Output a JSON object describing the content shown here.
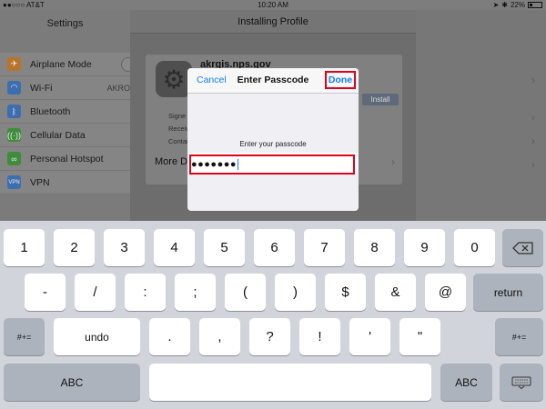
{
  "status": {
    "carrier": "●●○○○ AT&T",
    "time": "10:20 AM",
    "battery": "22%"
  },
  "sidebar": {
    "title": "Settings",
    "items": [
      {
        "label": "Airplane Mode",
        "icon": "airplane-icon",
        "color": "#b8742a",
        "value": ""
      },
      {
        "label": "Wi-Fi",
        "icon": "wifi-icon",
        "color": "#3d6eb0",
        "value": "AKRO"
      },
      {
        "label": "Bluetooth",
        "icon": "bluetooth-icon",
        "color": "#3d6eb0",
        "value": ""
      },
      {
        "label": "Cellular Data",
        "icon": "cellular-icon",
        "color": "#3f8c3b",
        "value": ""
      },
      {
        "label": "Personal Hotspot",
        "icon": "hotspot-icon",
        "color": "#3f8c3b",
        "value": ""
      },
      {
        "label": "VPN",
        "icon": "vpn-icon",
        "color": "#3d6eb0",
        "value": ""
      }
    ]
  },
  "sheet": {
    "title": "Installing Profile",
    "profile_name": "akrgis.nps.gov",
    "install_label": "Install",
    "meta": [
      "Signe",
      "Receive",
      "Contai"
    ],
    "more_details": "More De"
  },
  "dialog": {
    "cancel_label": "Cancel",
    "title": "Enter Passcode",
    "done_label": "Done",
    "prompt": "Enter your passcode",
    "passcode_masked": "●●●●●●●",
    "highlight_color": "#e0001b"
  },
  "keyboard": {
    "row1": [
      "1",
      "2",
      "3",
      "4",
      "5",
      "6",
      "7",
      "8",
      "9",
      "0"
    ],
    "row2": [
      "-",
      "/",
      ":",
      ";",
      "(",
      ")",
      "$",
      "&",
      "@"
    ],
    "return_label": "return",
    "shift_label": "#+=",
    "undo_label": "undo",
    "row3": [
      ".",
      ",",
      "?",
      "!",
      "'",
      "\""
    ],
    "abc_label": "ABC"
  }
}
